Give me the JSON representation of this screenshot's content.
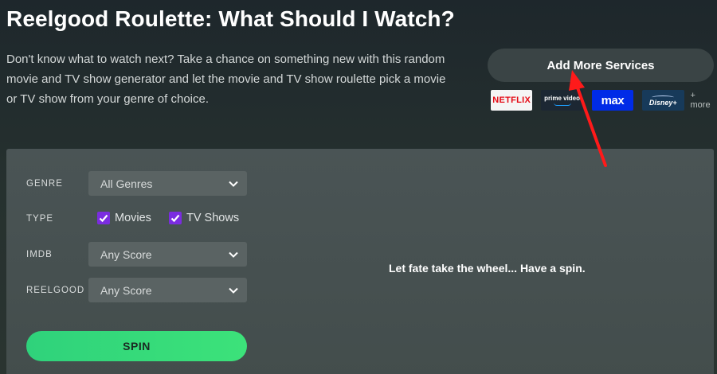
{
  "header": {
    "title": "Reelgood Roulette: What Should I Watch?",
    "intro_line1": "Don't know what to watch next? Take a chance on something new with this random",
    "intro_line2": "movie and TV show generator and let the movie and TV show roulette pick a movie",
    "intro_line3": "or TV show from your genre of choice."
  },
  "services": {
    "button_label": "Add More Services",
    "logos": [
      {
        "name": "NETFLIX",
        "color": "#e50914"
      },
      {
        "name": "prime video",
        "color": "#1ea0ff"
      },
      {
        "name": "max",
        "color": "#002be7"
      },
      {
        "name": "Disney+",
        "color": "#173a5a"
      }
    ],
    "more_label": "+ more"
  },
  "filters": {
    "genre_label": "GENRE",
    "genre_value": "All Genres",
    "type_label": "TYPE",
    "type_options": [
      {
        "label": "Movies",
        "checked": true
      },
      {
        "label": "TV Shows",
        "checked": true
      }
    ],
    "imdb_label": "IMDB",
    "imdb_value": "Any Score",
    "reelgood_label": "REELGOOD",
    "reelgood_value": "Any Score",
    "spin_label": "SPIN"
  },
  "result": {
    "placeholder": "Let fate take the wheel... Have a spin."
  },
  "colors": {
    "accent_green": "#3ce27a",
    "checkbox_purple": "#7b2ce0",
    "annotation_arrow": "#ff1a1a"
  }
}
